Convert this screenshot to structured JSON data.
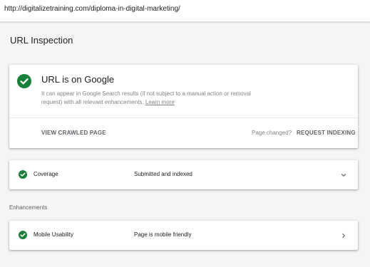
{
  "address_bar": {
    "url": "http://digitalizetraining.com/diploma-in-digital-marketing/"
  },
  "page": {
    "title": "URL Inspection"
  },
  "result_card": {
    "status_icon": "check-circle-icon",
    "headline": "URL is on Google",
    "description": "It can appear in Google Search results (if not subject to a manual action or removal request) with all relevant enhancements.",
    "learn_more": "Learn more",
    "view_crawled_label": "VIEW CRAWLED PAGE",
    "page_changed_text": "Page changed?",
    "request_indexing_label": "REQUEST INDEXING"
  },
  "coverage": {
    "icon": "check-circle-icon",
    "label": "Coverage",
    "value": "Submitted and indexed",
    "expand_icon": "chevron-down-icon"
  },
  "enhancements": {
    "section_label": "Enhancements",
    "items": [
      {
        "icon": "check-circle-icon",
        "label": "Mobile Usability",
        "value": "Page is mobile friendly",
        "open_icon": "chevron-right-icon"
      }
    ]
  },
  "colors": {
    "success": "#188038",
    "background": "#f5f5f5",
    "card": "#ffffff",
    "muted_text": "#80868b",
    "action_text": "#5f6368"
  }
}
